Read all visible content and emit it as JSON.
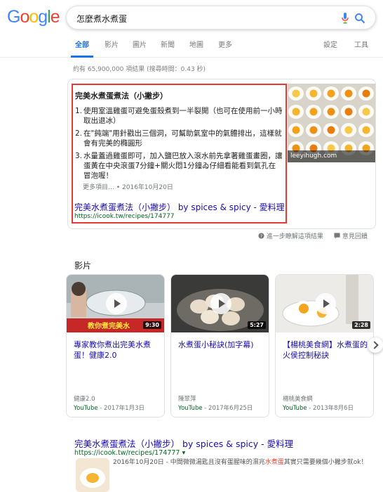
{
  "logo": {
    "g1": "G",
    "o1": "o",
    "o2": "o",
    "g2": "g",
    "l": "l",
    "e": "e"
  },
  "search": {
    "query": "怎麼煮水煮蛋"
  },
  "tabs": {
    "all": "全部",
    "videos": "影片",
    "images": "圖片",
    "news": "新聞",
    "maps": "地圖",
    "more": "更多",
    "settings": "設定",
    "tools": "工具"
  },
  "stats": "約有 65,900,000 項結果 (搜尋時間：0.43 秒)",
  "snippet": {
    "title": "完美水煮蛋煮法（小撇步）",
    "items": [
      {
        "num": "1.",
        "text": "使用室溫雞蛋可避免蛋殼煮到一半裂開（也可在使用前一小時取出退冰）"
      },
      {
        "num": "2.",
        "text": "在\"鈍端\"用針戳出三個洞，可幫助氣室中的氣體排出，這樣就會有完美的橢圓形"
      },
      {
        "num": "3.",
        "text": "水量蓋過雞蛋即可，加入鹽巴放入滾水前先拿著雞蛋畫圈，讓蛋黃在中央滾蛋7分鐘+關火悶1分鐘ゐ仔細看能看到氣孔在冒泡喔！"
      }
    ],
    "more": "更多項目… • 2016年10月20日",
    "link": "完美水煮蛋煮法（小撇步） by spices & spicy - 愛料理",
    "url": "https://icook.tw/recipes/174777",
    "image_caption": "leeyihugh.com"
  },
  "feedback": {
    "about": "進一步瞭解這項結果",
    "report": "意見回饋"
  },
  "videos": {
    "heading": "影片",
    "items": [
      {
        "title": "專家教你煮出完美水煮蛋！健康2.0",
        "duration": "9:30",
        "author": "健康2.0",
        "source": "YouTube",
        "date": "- 2017年1月3日"
      },
      {
        "title": "水煮蛋小秘訣(加字幕)",
        "duration": "5:27",
        "author": "陳翠萍",
        "source": "YouTube",
        "date": "- 2017年6月25日"
      },
      {
        "title": "【楊桃美食網】水煮蛋的火侯控制秘訣",
        "duration": "2:28",
        "author": "楊桃美食網",
        "source": "YouTube",
        "date": "- 2013年8月6日"
      }
    ],
    "thumb_overlay": "教你煮完美水"
  },
  "result": {
    "title": "完美水煮蛋煮法（小撇步） by spices & spicy - 愛料理",
    "url": "https://icook.tw/recipes/174777 ▾",
    "snippet_pre": "2016年10月20日 - 中間微微湯匙且沒有蛋腥味的濕兆",
    "snippet_hl": "水煮蛋",
    "snippet_post": "其實只需要幾個小撇步就ok！"
  },
  "colors": {
    "link": "#1a0dab",
    "url": "#006621",
    "accent": "#1a73e8",
    "highlight_box": "#e53935"
  }
}
